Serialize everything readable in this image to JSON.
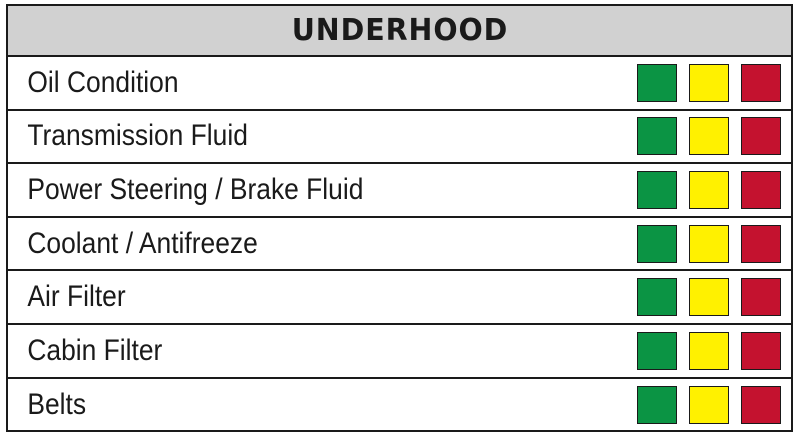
{
  "checklist": {
    "title": "UNDERHOOD",
    "status_colors": {
      "good": "#0b9444",
      "caution": "#fff100",
      "attention": "#c4122f"
    },
    "items": [
      {
        "label": "Oil Condition"
      },
      {
        "label": "Transmission Fluid"
      },
      {
        "label": "Power Steering / Brake Fluid"
      },
      {
        "label": "Coolant / Antifreeze"
      },
      {
        "label": "Air Filter"
      },
      {
        "label": "Cabin Filter"
      },
      {
        "label": "Belts"
      }
    ]
  }
}
